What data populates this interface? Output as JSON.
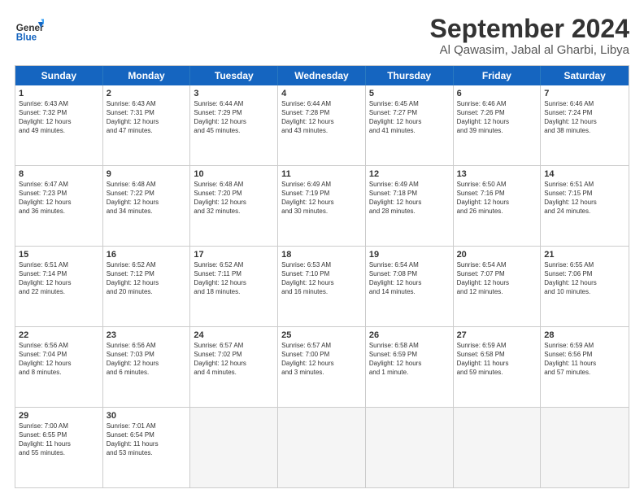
{
  "header": {
    "logo_line1": "General",
    "logo_line2": "Blue",
    "month": "September 2024",
    "location": "Al Qawasim, Jabal al Gharbi, Libya"
  },
  "days": [
    "Sunday",
    "Monday",
    "Tuesday",
    "Wednesday",
    "Thursday",
    "Friday",
    "Saturday"
  ],
  "rows": [
    [
      {
        "num": "1",
        "info": "Sunrise: 6:43 AM\nSunset: 7:32 PM\nDaylight: 12 hours\nand 49 minutes."
      },
      {
        "num": "2",
        "info": "Sunrise: 6:43 AM\nSunset: 7:31 PM\nDaylight: 12 hours\nand 47 minutes."
      },
      {
        "num": "3",
        "info": "Sunrise: 6:44 AM\nSunset: 7:29 PM\nDaylight: 12 hours\nand 45 minutes."
      },
      {
        "num": "4",
        "info": "Sunrise: 6:44 AM\nSunset: 7:28 PM\nDaylight: 12 hours\nand 43 minutes."
      },
      {
        "num": "5",
        "info": "Sunrise: 6:45 AM\nSunset: 7:27 PM\nDaylight: 12 hours\nand 41 minutes."
      },
      {
        "num": "6",
        "info": "Sunrise: 6:46 AM\nSunset: 7:26 PM\nDaylight: 12 hours\nand 39 minutes."
      },
      {
        "num": "7",
        "info": "Sunrise: 6:46 AM\nSunset: 7:24 PM\nDaylight: 12 hours\nand 38 minutes."
      }
    ],
    [
      {
        "num": "8",
        "info": "Sunrise: 6:47 AM\nSunset: 7:23 PM\nDaylight: 12 hours\nand 36 minutes."
      },
      {
        "num": "9",
        "info": "Sunrise: 6:48 AM\nSunset: 7:22 PM\nDaylight: 12 hours\nand 34 minutes."
      },
      {
        "num": "10",
        "info": "Sunrise: 6:48 AM\nSunset: 7:20 PM\nDaylight: 12 hours\nand 32 minutes."
      },
      {
        "num": "11",
        "info": "Sunrise: 6:49 AM\nSunset: 7:19 PM\nDaylight: 12 hours\nand 30 minutes."
      },
      {
        "num": "12",
        "info": "Sunrise: 6:49 AM\nSunset: 7:18 PM\nDaylight: 12 hours\nand 28 minutes."
      },
      {
        "num": "13",
        "info": "Sunrise: 6:50 AM\nSunset: 7:16 PM\nDaylight: 12 hours\nand 26 minutes."
      },
      {
        "num": "14",
        "info": "Sunrise: 6:51 AM\nSunset: 7:15 PM\nDaylight: 12 hours\nand 24 minutes."
      }
    ],
    [
      {
        "num": "15",
        "info": "Sunrise: 6:51 AM\nSunset: 7:14 PM\nDaylight: 12 hours\nand 22 minutes."
      },
      {
        "num": "16",
        "info": "Sunrise: 6:52 AM\nSunset: 7:12 PM\nDaylight: 12 hours\nand 20 minutes."
      },
      {
        "num": "17",
        "info": "Sunrise: 6:52 AM\nSunset: 7:11 PM\nDaylight: 12 hours\nand 18 minutes."
      },
      {
        "num": "18",
        "info": "Sunrise: 6:53 AM\nSunset: 7:10 PM\nDaylight: 12 hours\nand 16 minutes."
      },
      {
        "num": "19",
        "info": "Sunrise: 6:54 AM\nSunset: 7:08 PM\nDaylight: 12 hours\nand 14 minutes."
      },
      {
        "num": "20",
        "info": "Sunrise: 6:54 AM\nSunset: 7:07 PM\nDaylight: 12 hours\nand 12 minutes."
      },
      {
        "num": "21",
        "info": "Sunrise: 6:55 AM\nSunset: 7:06 PM\nDaylight: 12 hours\nand 10 minutes."
      }
    ],
    [
      {
        "num": "22",
        "info": "Sunrise: 6:56 AM\nSunset: 7:04 PM\nDaylight: 12 hours\nand 8 minutes."
      },
      {
        "num": "23",
        "info": "Sunrise: 6:56 AM\nSunset: 7:03 PM\nDaylight: 12 hours\nand 6 minutes."
      },
      {
        "num": "24",
        "info": "Sunrise: 6:57 AM\nSunset: 7:02 PM\nDaylight: 12 hours\nand 4 minutes."
      },
      {
        "num": "25",
        "info": "Sunrise: 6:57 AM\nSunset: 7:00 PM\nDaylight: 12 hours\nand 3 minutes."
      },
      {
        "num": "26",
        "info": "Sunrise: 6:58 AM\nSunset: 6:59 PM\nDaylight: 12 hours\nand 1 minute."
      },
      {
        "num": "27",
        "info": "Sunrise: 6:59 AM\nSunset: 6:58 PM\nDaylight: 11 hours\nand 59 minutes."
      },
      {
        "num": "28",
        "info": "Sunrise: 6:59 AM\nSunset: 6:56 PM\nDaylight: 11 hours\nand 57 minutes."
      }
    ],
    [
      {
        "num": "29",
        "info": "Sunrise: 7:00 AM\nSunset: 6:55 PM\nDaylight: 11 hours\nand 55 minutes."
      },
      {
        "num": "30",
        "info": "Sunrise: 7:01 AM\nSunset: 6:54 PM\nDaylight: 11 hours\nand 53 minutes."
      },
      {
        "num": "",
        "info": ""
      },
      {
        "num": "",
        "info": ""
      },
      {
        "num": "",
        "info": ""
      },
      {
        "num": "",
        "info": ""
      },
      {
        "num": "",
        "info": ""
      }
    ]
  ]
}
